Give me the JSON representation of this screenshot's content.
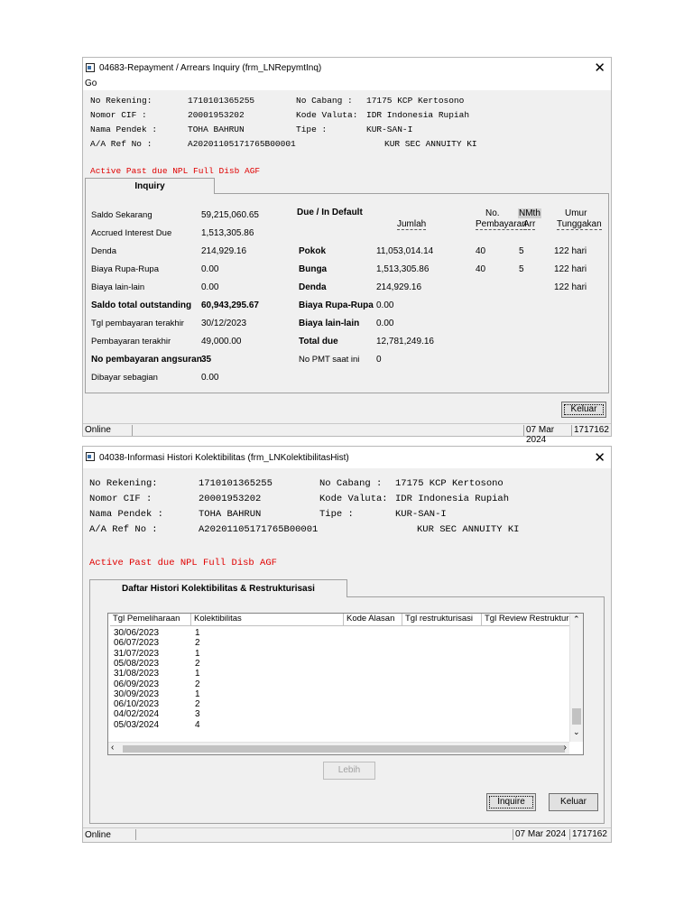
{
  "win1": {
    "title": "04683-Repayment / Arrears Inquiry    (frm_LNRepymtInq)",
    "menu": "Go",
    "info": {
      "no_rekening_label": "No Rekening:",
      "no_rekening": "1710101365255",
      "nomor_cif_label": "Nomor CIF  :",
      "nomor_cif": "20001953202",
      "nama_pendek_label": "Nama Pendek :",
      "nama_pendek": "TOHA BAHRUN",
      "aa_ref_label": "A/A Ref No :",
      "aa_ref": "A20201105171765B00001",
      "no_cabang_label": "No Cabang  :",
      "no_cabang": "17175  KCP Kertosono",
      "kode_valuta_label": "Kode Valuta:",
      "kode_valuta": "IDR  Indonesia Rupiah",
      "tipe_label": "Tipe      :",
      "tipe": "KUR-SAN-I",
      "product": "KUR SEC ANNUITY KI"
    },
    "flags": "Active  Past due  NPL  Full Disb  AGF",
    "tab": "Inquiry",
    "left": [
      {
        "label": "Saldo Sekarang",
        "value": "59,215,060.65",
        "bold": false
      },
      {
        "label": "Accrued Interest Due",
        "value": "1,513,305.86",
        "bold": false
      },
      {
        "label": "Denda",
        "value": "214,929.16",
        "bold": false
      },
      {
        "label": "Biaya Rupa-Rupa",
        "value": "0.00",
        "bold": false
      },
      {
        "label": "Biaya lain-lain",
        "value": "0.00",
        "bold": false
      },
      {
        "label": "Saldo total outstanding",
        "value": "60,943,295.67",
        "bold": true
      },
      {
        "label": "Tgl pembayaran terakhir",
        "value": "30/12/2023",
        "bold": false
      },
      {
        "label": "Pembayaran terakhir",
        "value": "49,000.00",
        "bold": false
      },
      {
        "label": "No pembayaran angsuran",
        "value": "35",
        "bold": true
      },
      {
        "label": "Dibayar sebagian",
        "value": "0.00",
        "bold": false
      }
    ],
    "due_title": "Due / In Default",
    "col_jumlah": "Jumlah",
    "col_no_line1": "No.",
    "col_no_line2": "Pembayaran",
    "col_nmth_line1": "NMth",
    "col_nmth_line2": "Arr",
    "col_umur_line1": "Umur",
    "col_umur_line2": "Tunggakan",
    "due_rows": [
      {
        "label": "Pokok",
        "bold": true,
        "jumlah": "11,053,014.14",
        "no": "40",
        "nmth": "5",
        "umur": "122 hari"
      },
      {
        "label": "Bunga",
        "bold": true,
        "jumlah": "1,513,305.86",
        "no": "40",
        "nmth": "5",
        "umur": "122 hari"
      },
      {
        "label": "Denda",
        "bold": true,
        "jumlah": "214,929.16",
        "no": "",
        "nmth": "",
        "umur": "122 hari"
      },
      {
        "label": "Biaya Rupa-Rupa",
        "bold": true,
        "jumlah": "0.00",
        "no": "",
        "nmth": "",
        "umur": ""
      },
      {
        "label": "Biaya lain-lain",
        "bold": true,
        "jumlah": "0.00",
        "no": "",
        "nmth": "",
        "umur": ""
      },
      {
        "label": "Total due",
        "bold": true,
        "jumlah": "12,781,249.16",
        "no": "",
        "nmth": "",
        "umur": ""
      },
      {
        "label": "No PMT saat ini",
        "bold": false,
        "jumlah": "0",
        "no": "",
        "nmth": "",
        "umur": ""
      }
    ],
    "keluar": "Keluar",
    "status_left": "Online",
    "status_date": "07 Mar 2024",
    "status_code": "1717162"
  },
  "win2": {
    "title": "04038-Informasi Histori Kolektibilitas    (frm_LNKolektibilitasHist)",
    "info": {
      "no_rekening_label": "No Rekening:",
      "no_rekening": "1710101365255",
      "nomor_cif_label": "Nomor CIF  :",
      "nomor_cif": "20001953202",
      "nama_pendek_label": "Nama Pendek :",
      "nama_pendek": "TOHA BAHRUN",
      "aa_ref_label": "A/A Ref No :",
      "aa_ref": "A20201105171765B00001",
      "no_cabang_label": "No Cabang  :",
      "no_cabang": "17175  KCP Kertosono",
      "kode_valuta_label": "Kode Valuta:",
      "kode_valuta": "IDR  Indonesia Rupiah",
      "tipe_label": "Tipe      :",
      "tipe": "KUR-SAN-I",
      "product": "KUR SEC ANNUITY KI"
    },
    "flags": "Active  Past due  NPL  Full Disb  AGF",
    "tab": "Daftar Histori Kolektibilitas & Restrukturisasi",
    "columns": [
      "Tgl Pemeliharaan",
      "Kolektibilitas",
      "Kode Alasan",
      "Tgl restrukturisasi",
      "Tgl Review Restrukturisa"
    ],
    "rows": [
      {
        "date": "30/06/2023",
        "kol": "1"
      },
      {
        "date": "06/07/2023",
        "kol": "2"
      },
      {
        "date": "31/07/2023",
        "kol": "1"
      },
      {
        "date": "05/08/2023",
        "kol": "2"
      },
      {
        "date": "31/08/2023",
        "kol": "1"
      },
      {
        "date": "06/09/2023",
        "kol": "2"
      },
      {
        "date": "30/09/2023",
        "kol": "1"
      },
      {
        "date": "06/10/2023",
        "kol": "2"
      },
      {
        "date": "04/02/2024",
        "kol": "3"
      },
      {
        "date": "05/03/2024",
        "kol": "4"
      }
    ],
    "lebih": "Lebih",
    "inquire": "Inquire",
    "keluar": "Keluar",
    "status_left": "Online",
    "status_date": "07 Mar 2024",
    "status_code": "1717162"
  }
}
